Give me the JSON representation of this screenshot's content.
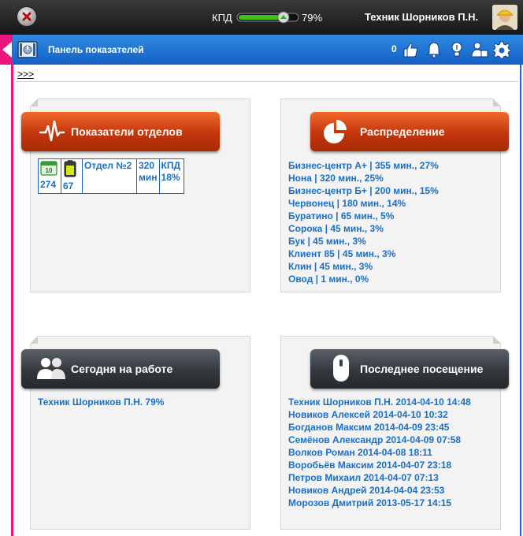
{
  "topbar": {
    "kpd_label": "КПД",
    "kpd_percent": "79%",
    "kpd_value": 0.79,
    "user_name": "Техник Шорников П.Н."
  },
  "panel": {
    "title": "Панель показателей",
    "notification_count": "0",
    "breadcrumb": ">>>"
  },
  "colors": {
    "header_blue": "#1a6fd6",
    "accent_pink": "#e9167d",
    "orange": "#d4420f",
    "link_blue": "#1a6fc8"
  },
  "cards": {
    "departments": {
      "title": "Показатели отделов",
      "table": {
        "calendar_count": "274",
        "battery_count": "67",
        "dept_name": "Отдел №2",
        "minutes_value": "320",
        "minutes_unit": "мин",
        "kpd_label": "КПД",
        "kpd_value": "18%"
      }
    },
    "distribution": {
      "title": "Распределение",
      "items": [
        "Бизнес-центр А+ | 355 мин., 27%",
        "Нона | 320 мин., 25%",
        "Бизнес-центр Б+ | 200 мин., 15%",
        "Червонец | 180 мин., 14%",
        "Буратино | 65 мин., 5%",
        "Сорока | 45 мин., 3%",
        "Бук | 45 мин., 3%",
        "Клиент 85 | 45 мин., 3%",
        "Клин | 45 мин., 3%",
        "Овод | 1 мин., 0%"
      ]
    },
    "today": {
      "title": "Сегодня на работе",
      "items": [
        "Техник Шорников П.Н. 79%"
      ]
    },
    "last_visit": {
      "title": "Последнее посещение",
      "items": [
        "Техник Шорников П.Н. 2014-04-10 14:48",
        "Новиков Алексей 2014-04-10 10:32",
        "Богданов Максим 2014-04-09 23:45",
        "Семёнов Александр 2014-04-09 07:58",
        "Волков Роман 2014-04-08 18:11",
        "Воробьёв Максим 2014-04-07 23:18",
        "Петров Михаил 2014-04-07 07:13",
        "Новиков Андрей 2014-04-04 23:53",
        "Морозов Дмитрий 2013-05-17 14:15"
      ]
    }
  }
}
